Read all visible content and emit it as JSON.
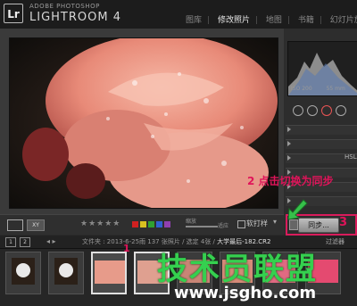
{
  "header": {
    "logo": "Lr",
    "brand_small": "ADOBE PHOTOSHOP",
    "brand_big": "LIGHTROOM 4",
    "modules": [
      {
        "label": "图库",
        "active": false
      },
      {
        "label": "修改照片",
        "active": true
      },
      {
        "label": "地图",
        "active": false
      },
      {
        "label": "书籍",
        "active": false
      },
      {
        "label": "幻灯片放",
        "active": false
      }
    ]
  },
  "histogram": {
    "iso": "ISO 200",
    "focal": "55 mm"
  },
  "right_panel": {
    "hsl_label": "HSL"
  },
  "toolbar": {
    "compare_label": "XY",
    "stars": "★★★★★",
    "zoom_label": "缩放",
    "fit_label": "适应",
    "soft_proof": "软打样",
    "label_colors": [
      "#d02020",
      "#d8c020",
      "#30a030",
      "#3060d0",
      "#9040b0"
    ]
  },
  "sync": {
    "button": "同步...",
    "callout_step": "3"
  },
  "callout_2": "2 点击切换为同步",
  "callout_1": "1",
  "filmstrip_bar": {
    "tab1": "1",
    "tab2": "2",
    "info": "文件夹 : 2013-6-25雨 137 张照片 / 选定 4张 / ",
    "filename": "大学最后-182.CR2",
    "filter": "过滤器"
  },
  "watermark": {
    "logo": "技术员联盟",
    "url": "www.jsgho.com"
  }
}
